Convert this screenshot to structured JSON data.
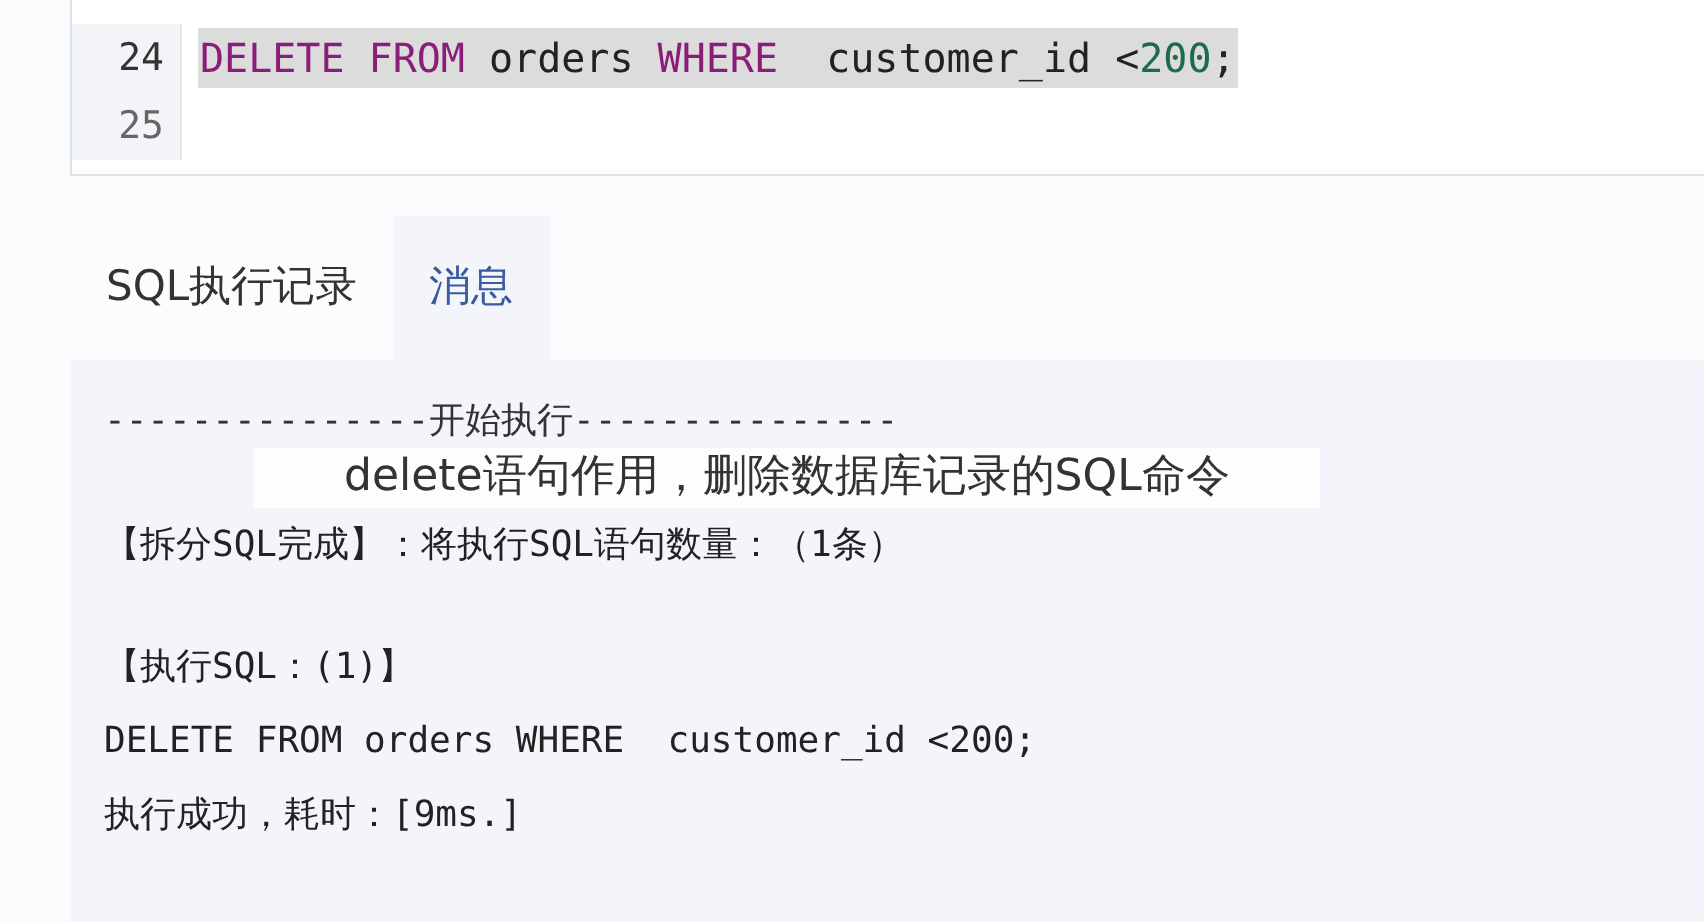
{
  "editor": {
    "lines": [
      {
        "number": "24",
        "selected": true,
        "tokens": [
          {
            "text": "DELETE ",
            "kind": "keyword"
          },
          {
            "text": "FROM",
            "kind": "keyword"
          },
          {
            "text": " orders ",
            "kind": "plain"
          },
          {
            "text": "WHERE",
            "kind": "keyword"
          },
          {
            "text": "  customer_id <",
            "kind": "plain"
          },
          {
            "text": "200",
            "kind": "number"
          },
          {
            "text": ";",
            "kind": "plain"
          }
        ]
      },
      {
        "number": "25",
        "selected": false
      }
    ]
  },
  "tabs": [
    {
      "label": "SQL执行记录",
      "selected": false
    },
    {
      "label": "消息",
      "selected": true
    }
  ],
  "messages": [
    {
      "kind": "divider",
      "text": "---------------开始执行---------------"
    },
    {
      "kind": "caption",
      "text": "delete语句作用，删除数据库记录的SQL命令"
    },
    {
      "kind": "text",
      "text": "【拆分SQL完成】：将执行SQL语句数量：（1条）"
    },
    {
      "kind": "gap"
    },
    {
      "kind": "text",
      "text": "【执行SQL：(1)】"
    },
    {
      "kind": "text",
      "text": "DELETE FROM orders WHERE  customer_id <200;"
    },
    {
      "kind": "text",
      "text": "执行成功，耗时：[9ms.]"
    }
  ]
}
